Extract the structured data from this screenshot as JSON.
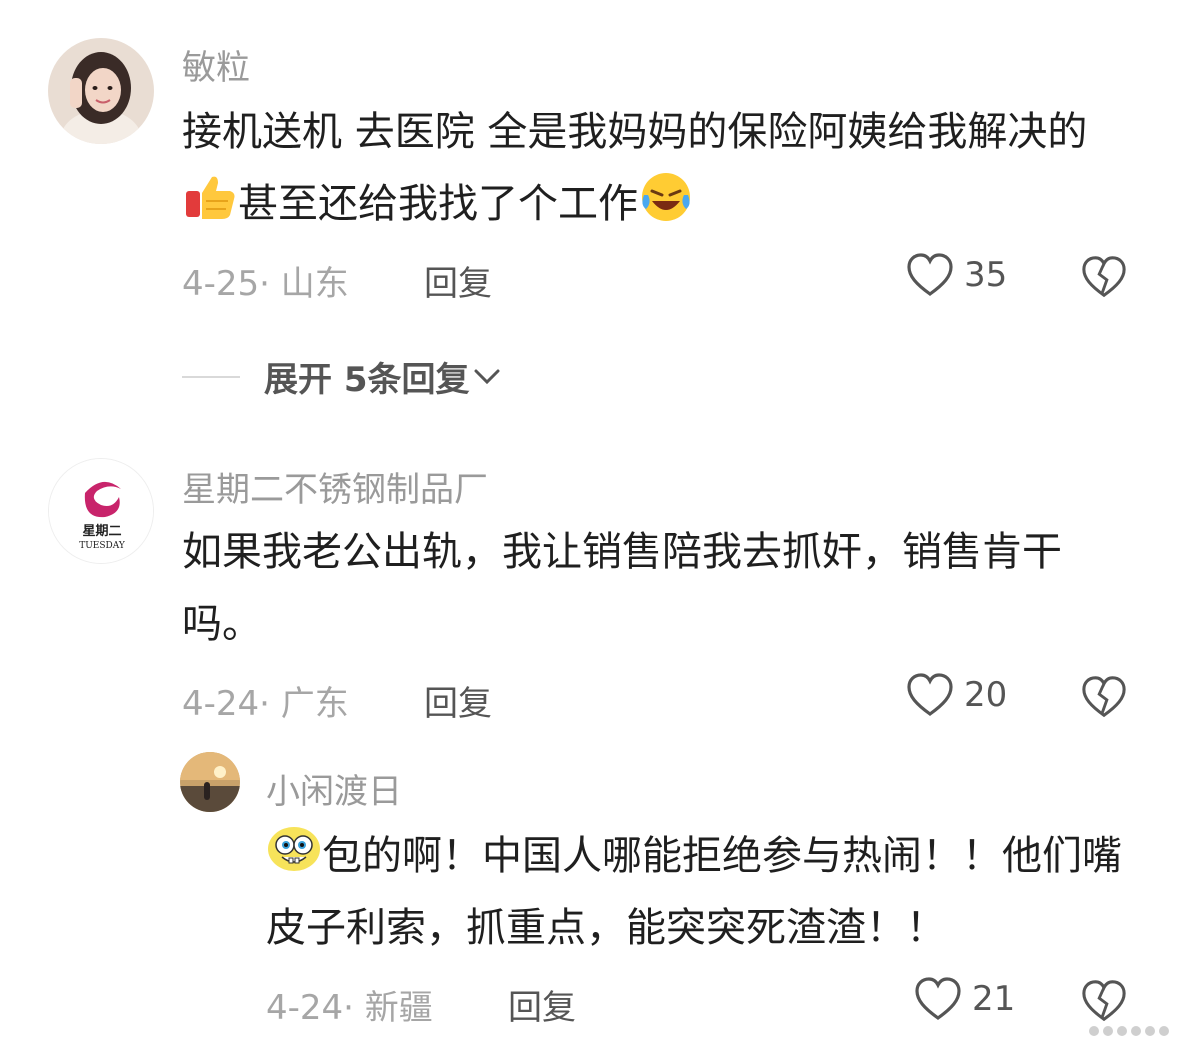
{
  "comments": [
    {
      "username": "敏粒",
      "text_before": "接机送机 去医院 全是我妈妈的保险阿姨给我解决的",
      "emoji_1": "thumbs-up-emoji",
      "text_middle": "甚至还给我找了个工作",
      "emoji_2": "laughing-crying-emoji",
      "date_location": "4-25· 山东",
      "reply_label": "回复",
      "likes": "35"
    },
    {
      "username": "星期二不锈钢制品厂",
      "avatar_text_1": "星期二",
      "avatar_text_2": "TUESDAY",
      "text": "如果我老公出轨，我让销售陪我去抓奸，销售肯干吗。",
      "date_location": "4-24· 广东",
      "reply_label": "回复",
      "likes": "20"
    },
    {
      "username": "小闲渡日",
      "emoji_1": "spongebob-emoji",
      "text": "包的啊！中国人哪能拒绝参与热闹！！他们嘴皮子利索，抓重点，能突突死渣渣！！",
      "date_location": "4-24· 新疆",
      "reply_label": "回复",
      "likes": "21"
    }
  ],
  "expand_replies": "展开 5条回复",
  "colors": {
    "text": "#1f1f1f",
    "muted": "#9a9a9a",
    "action": "#555555"
  }
}
